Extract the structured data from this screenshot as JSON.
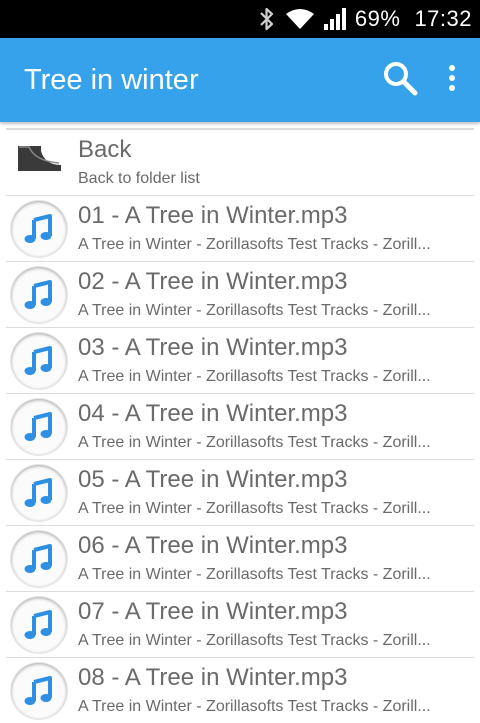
{
  "status_bar": {
    "battery": "69%",
    "time": "17:32",
    "icons": [
      "bluetooth-icon",
      "wifi-icon",
      "signal-icon"
    ]
  },
  "app_bar": {
    "title": "Tree in winter",
    "actions": [
      "search-icon",
      "overflow-menu-icon"
    ],
    "color": "#36a2ec"
  },
  "back_item": {
    "title": "Back",
    "subtitle": "Back to folder list",
    "icon": "back-arrow-icon"
  },
  "tracks": [
    {
      "title": "01 - A Tree in Winter.mp3",
      "subtitle": "A Tree in Winter - Zorillasofts Test Tracks - Zorill..."
    },
    {
      "title": "02 - A Tree in Winter.mp3",
      "subtitle": "A Tree in Winter - Zorillasofts Test Tracks - Zorill..."
    },
    {
      "title": "03 - A Tree in Winter.mp3",
      "subtitle": "A Tree in Winter - Zorillasofts Test Tracks - Zorill..."
    },
    {
      "title": "04 - A Tree in Winter.mp3",
      "subtitle": "A Tree in Winter - Zorillasofts Test Tracks - Zorill..."
    },
    {
      "title": "05 - A Tree in Winter.mp3",
      "subtitle": "A Tree in Winter - Zorillasofts Test Tracks - Zorill..."
    },
    {
      "title": "06 - A Tree in Winter.mp3",
      "subtitle": "A Tree in Winter - Zorillasofts Test Tracks - Zorill..."
    },
    {
      "title": "07 - A Tree in Winter.mp3",
      "subtitle": "A Tree in Winter - Zorillasofts Test Tracks - Zorill..."
    },
    {
      "title": "08 - A Tree in Winter.mp3",
      "subtitle": "A Tree in Winter - Zorillasofts Test Tracks - Zorill..."
    }
  ],
  "track_icon": "music-note-icon",
  "note_color": "#2f8fe0"
}
